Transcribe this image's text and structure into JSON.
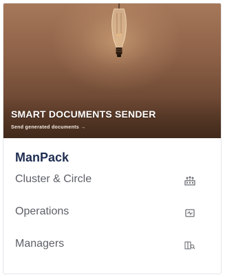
{
  "card": {
    "hero_title": "SMART DOCUMENTS SENDER",
    "hero_subtitle": "Send generated documents →",
    "app_name": "ManPack",
    "items": [
      {
        "label": "Cluster & Circle",
        "icon": "cluster-icon"
      },
      {
        "label": "Operations",
        "icon": "operations-monitor-icon"
      },
      {
        "label": "Managers",
        "icon": "managers-search-icon"
      }
    ]
  },
  "colors": {
    "app_name": "#1f2d52",
    "item_text": "#5b5f66",
    "icon": "#6c6f75",
    "hero_dark": "#553725",
    "hero_light": "#a6785a"
  }
}
